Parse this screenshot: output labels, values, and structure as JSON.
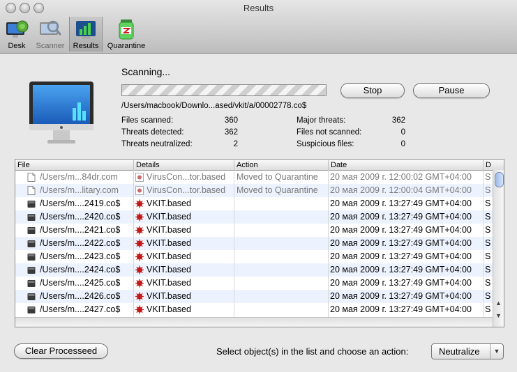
{
  "window": {
    "title": "Results"
  },
  "toolbar": {
    "items": [
      {
        "label": "Desk"
      },
      {
        "label": "Scanner"
      },
      {
        "label": "Results"
      },
      {
        "label": "Quarantine"
      }
    ]
  },
  "scan": {
    "status": "Scanning...",
    "path": "/Users/macbook/Downlo...ased/vkit/a/00002778.co$",
    "stop_label": "Stop",
    "pause_label": "Pause"
  },
  "stats": {
    "files_scanned_label": "Files scanned:",
    "files_scanned": "360",
    "threats_detected_label": "Threats detected:",
    "threats_detected": "362",
    "threats_neutralized_label": "Threats neutralized:",
    "threats_neutralized": "2",
    "major_threats_label": "Major threats:",
    "major_threats": "362",
    "files_not_scanned_label": "Files not scanned:",
    "files_not_scanned": "0",
    "suspicious_label": "Suspicious files:",
    "suspicious": "0"
  },
  "table": {
    "columns": [
      "File",
      "Details",
      "Action",
      "Date",
      "D"
    ],
    "rows": [
      {
        "file": "/Users/m...84dr.com",
        "details": "VirusCon...tor.based",
        "action": "Moved to Quarantine",
        "date": "20 мая 2009 г. 12:00:02 GMT+04:00",
        "d": "S",
        "processed": true
      },
      {
        "file": "/Users/m...litary.com",
        "details": "VirusCon...tor.based",
        "action": "Moved to Quarantine",
        "date": "20 мая 2009 г. 12:00:04 GMT+04:00",
        "d": "S",
        "processed": true
      },
      {
        "file": "/Users/m....2419.co$",
        "details": "VKIT.based",
        "action": "",
        "date": "20 мая 2009 г. 13:27:49 GMT+04:00",
        "d": "S",
        "processed": false
      },
      {
        "file": "/Users/m....2420.co$",
        "details": "VKIT.based",
        "action": "",
        "date": "20 мая 2009 г. 13:27:49 GMT+04:00",
        "d": "S",
        "processed": false
      },
      {
        "file": "/Users/m....2421.co$",
        "details": "VKIT.based",
        "action": "",
        "date": "20 мая 2009 г. 13:27:49 GMT+04:00",
        "d": "S",
        "processed": false
      },
      {
        "file": "/Users/m....2422.co$",
        "details": "VKIT.based",
        "action": "",
        "date": "20 мая 2009 г. 13:27:49 GMT+04:00",
        "d": "S",
        "processed": false
      },
      {
        "file": "/Users/m....2423.co$",
        "details": "VKIT.based",
        "action": "",
        "date": "20 мая 2009 г. 13:27:49 GMT+04:00",
        "d": "S",
        "processed": false
      },
      {
        "file": "/Users/m....2424.co$",
        "details": "VKIT.based",
        "action": "",
        "date": "20 мая 2009 г. 13:27:49 GMT+04:00",
        "d": "S",
        "processed": false
      },
      {
        "file": "/Users/m....2425.co$",
        "details": "VKIT.based",
        "action": "",
        "date": "20 мая 2009 г. 13:27:49 GMT+04:00",
        "d": "S",
        "processed": false
      },
      {
        "file": "/Users/m....2426.co$",
        "details": "VKIT.based",
        "action": "",
        "date": "20 мая 2009 г. 13:27:49 GMT+04:00",
        "d": "S",
        "processed": false
      },
      {
        "file": "/Users/m....2427.co$",
        "details": "VKIT.based",
        "action": "",
        "date": "20 мая 2009 г. 13:27:49 GMT+04:00",
        "d": "S",
        "processed": false
      }
    ]
  },
  "footer": {
    "clear_label": "Clear Processeed",
    "prompt": "Select object(s) in the list and choose an action:",
    "action_value": "Neutralize"
  },
  "icons": [
    "desk-icon",
    "scanner-icon",
    "results-icon",
    "quarantine-icon",
    "monitor-icon",
    "document-icon",
    "virus-icon",
    "chevron-down-icon"
  ],
  "colors": {
    "row_alt": "#edf3fe",
    "virus": "#c21a1a"
  }
}
